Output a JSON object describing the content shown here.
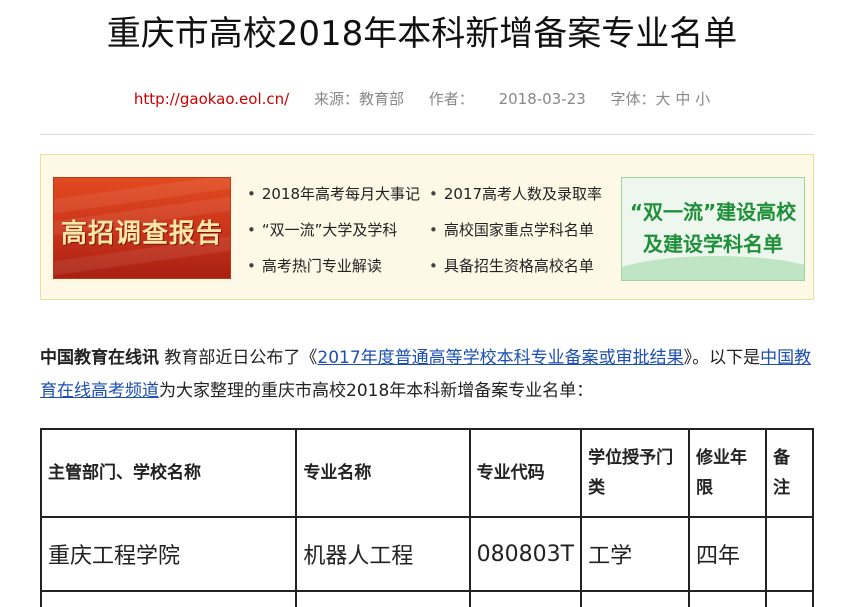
{
  "article": {
    "title": "重庆市高校2018年本科新增备案专业名单",
    "url": "http://gaokao.eol.cn/",
    "source": "来源：教育部",
    "author": "作者：",
    "date": "2018-03-23",
    "font_label": "字体：大  中  小"
  },
  "promo": {
    "left_banner": "高招调查报告",
    "links": [
      "2018年高考每月大事记",
      "2017高考人数及录取率",
      "“双一流”大学及学科",
      "高校国家重点学科名单",
      "高考热门专业解读",
      "具备招生资格高校名单"
    ],
    "right_banner_line1": "“双一流”建设高校",
    "right_banner_line2": "及建设学科名单"
  },
  "intro": {
    "org": "中国教育在线讯",
    "text1": " 教育部近日公布了《",
    "link1": "2017年度普通高等学校本科专业备案或审批结果",
    "text2": "》。以下是",
    "link2": "中国教育在线高考频道",
    "text3": "为大家整理的重庆市高校2018年本科新增备案专业名单："
  },
  "table": {
    "headers": [
      "主管部门、学校名称",
      "专业名称",
      "专业代码",
      "学位授予门类",
      "修业年限",
      "备注"
    ],
    "rows": [
      [
        "重庆工程学院",
        "机器人工程",
        "080803T",
        "工学",
        "四年",
        ""
      ]
    ]
  }
}
